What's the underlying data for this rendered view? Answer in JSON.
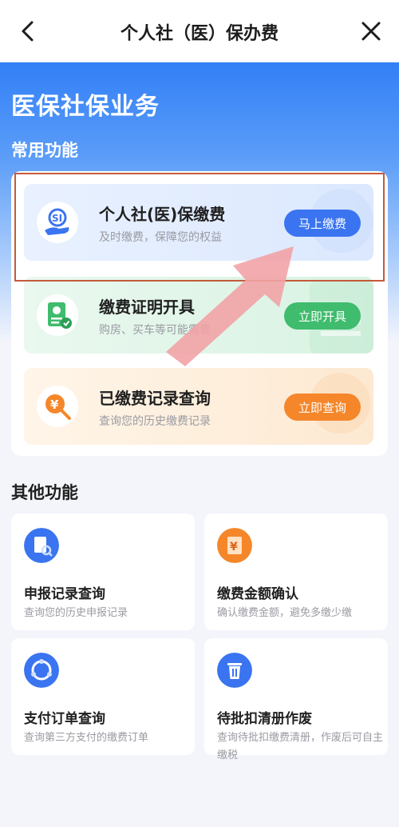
{
  "header": {
    "title": "个人社（医）保办费"
  },
  "hero": {
    "title": "医保社保业务",
    "section_common": "常用功能"
  },
  "common": [
    {
      "title": "个人社(医)保缴费",
      "desc": "及时缴费，保障您的权益",
      "button": "马上缴费"
    },
    {
      "title": "缴费证明开具",
      "desc": "购房、买车等可能需要",
      "button": "立即开具"
    },
    {
      "title": "已缴费记录查询",
      "desc": "查询您的历史缴费记录",
      "button": "立即查询"
    }
  ],
  "other": {
    "section_title": "其他功能",
    "tiles": [
      {
        "title": "申报记录查询",
        "desc": "查询您的历史申报记录"
      },
      {
        "title": "缴费金额确认",
        "desc": "确认缴费金额，避免多缴少缴"
      },
      {
        "title": "支付订单查询",
        "desc": "查询第三方支付的缴费订单"
      },
      {
        "title": "待批扣清册作废",
        "desc": "查询待批扣缴费清册，作废后可自主缴税"
      }
    ]
  },
  "colors": {
    "primary_blue": "#3a74f0",
    "green": "#3fbc6d",
    "orange": "#f5862a",
    "highlight_box": "#c45a3b",
    "arrow": "#f2a3a6"
  },
  "icons": {
    "back": "chevron-left-icon",
    "close": "close-icon",
    "social_insurance": "social-security-hand-icon",
    "certificate": "certificate-icon",
    "record_search": "yen-search-icon",
    "declare_record": "document-search-icon",
    "amount_confirm": "yen-document-icon",
    "order": "circular-arrows-icon",
    "void_list": "trash-icon"
  }
}
